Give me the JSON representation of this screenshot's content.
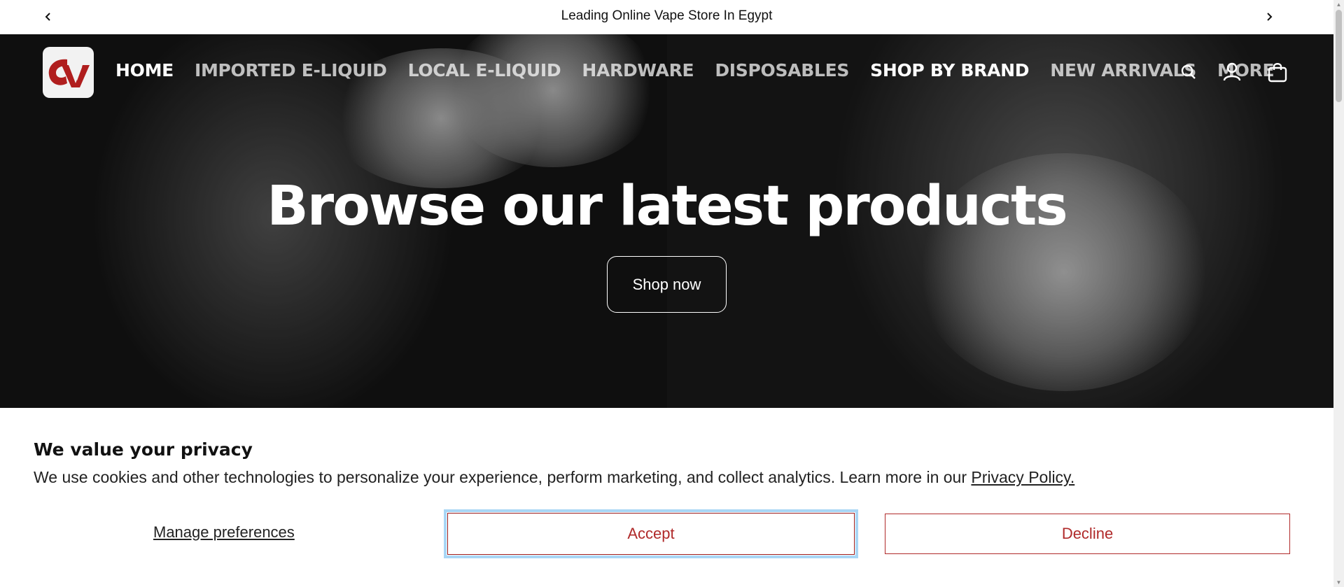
{
  "announcement": {
    "text": "Leading Online Vape Store In Egypt",
    "prev_icon": "chevron-left-icon",
    "next_icon": "chevron-right-icon"
  },
  "header": {
    "logo_icon": "store-logo",
    "nav": [
      {
        "label": "HOME",
        "active": true
      },
      {
        "label": "IMPORTED E-LIQUID"
      },
      {
        "label": "LOCAL E-LIQUID"
      },
      {
        "label": "HARDWARE"
      },
      {
        "label": "DISPOSABLES"
      },
      {
        "label": "SHOP BY BRAND"
      },
      {
        "label": "NEW ARRIVALS"
      },
      {
        "label": "MORE"
      }
    ],
    "icons": [
      "search-icon",
      "account-icon",
      "cart-icon"
    ]
  },
  "hero": {
    "title": "Browse our latest products",
    "cta": "Shop now"
  },
  "cookie": {
    "title": "We value your privacy",
    "message": "We use cookies and other technologies to personalize your experience, perform marketing, and collect analytics. Learn more in our ",
    "policy_link": "Privacy Policy.",
    "manage": "Manage preferences",
    "accept": "Accept",
    "decline": "Decline"
  },
  "colors": {
    "accent": "#b02a2a",
    "focus_ring": "#a9d6f5",
    "logo_red": "#b01e1e"
  }
}
